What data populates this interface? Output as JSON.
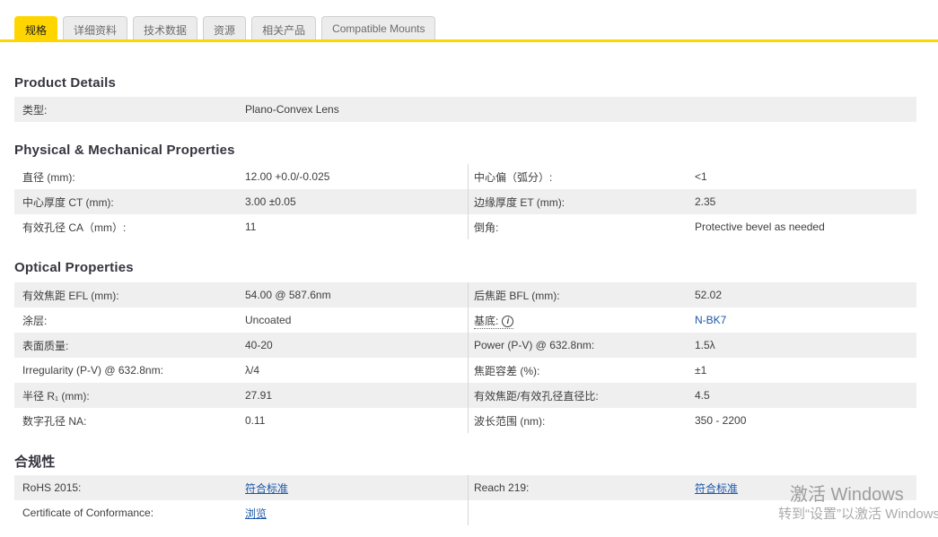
{
  "tabs": [
    {
      "label": "规格",
      "active": true
    },
    {
      "label": "详细资料",
      "active": false
    },
    {
      "label": "技术数据",
      "active": false
    },
    {
      "label": "资源",
      "active": false
    },
    {
      "label": "相关产品",
      "active": false
    },
    {
      "label": "Compatible Mounts",
      "active": false
    }
  ],
  "sections": [
    {
      "title": "Product Details",
      "rows": [
        {
          "cells": [
            {
              "label": "类型:",
              "value": "Plano-Convex Lens",
              "full": true
            }
          ]
        }
      ]
    },
    {
      "title": "Physical & Mechanical Properties",
      "rows": [
        {
          "cells": [
            {
              "label": "直径 (mm):",
              "value": "12.00 +0.0/-0.025"
            },
            {
              "label": "中心偏（弧分）:",
              "value": "<1"
            }
          ]
        },
        {
          "cells": [
            {
              "label": "中心厚度 CT (mm):",
              "value": "3.00 ±0.05"
            },
            {
              "label": "边缘厚度 ET (mm):",
              "value": "2.35"
            }
          ]
        },
        {
          "cells": [
            {
              "label": "有效孔径 CA（mm）:",
              "value": "11"
            },
            {
              "label": "倒角:",
              "value": "Protective bevel as needed"
            }
          ]
        }
      ]
    },
    {
      "title": "Optical Properties",
      "rows": [
        {
          "cells": [
            {
              "label": "有效焦距 EFL (mm):",
              "value": "54.00 @ 587.6nm"
            },
            {
              "label": "后焦距 BFL (mm):",
              "value": "52.02"
            }
          ]
        },
        {
          "cells": [
            {
              "label": "涂层:",
              "value": "Uncoated"
            },
            {
              "label": "基底:",
              "value": "N-BK7",
              "link": true,
              "underline": false,
              "dotted": true,
              "info": true
            }
          ]
        },
        {
          "cells": [
            {
              "label": "表面质量:",
              "value": "40-20"
            },
            {
              "label": "Power (P-V) @ 632.8nm:",
              "value": "1.5λ"
            }
          ]
        },
        {
          "cells": [
            {
              "label": "Irregularity (P-V) @ 632.8nm:",
              "value": "λ/4"
            },
            {
              "label": "焦距容差 (%):",
              "value": "±1"
            }
          ]
        },
        {
          "cells": [
            {
              "label": "半径 R₁ (mm):",
              "value": "27.91"
            },
            {
              "label": "有效焦距/有效孔径直径比:",
              "value": "4.5"
            }
          ]
        },
        {
          "cells": [
            {
              "label": "数字孔径 NA:",
              "value": "0.11"
            },
            {
              "label": "波长范围 (nm):",
              "value": "350 - 2200"
            }
          ]
        }
      ]
    },
    {
      "title": "合规性",
      "rows": [
        {
          "cells": [
            {
              "label": "RoHS 2015:",
              "value": "符合标准",
              "link": true
            },
            {
              "label": "Reach 219:",
              "value": "符合标准",
              "link": true
            }
          ]
        },
        {
          "cells": [
            {
              "label": "Certificate of Conformance:",
              "value": "浏览",
              "link": true
            }
          ]
        }
      ]
    }
  ],
  "info_icon_glyph": "i",
  "watermark": {
    "line1": "激活 Windows",
    "line2": "转到“设置”以激活 Windows"
  },
  "colors": {
    "accent_yellow": "#ffd500",
    "link_blue": "#1b57a8",
    "row_gray": "#efefef",
    "heading": "#35353f"
  }
}
